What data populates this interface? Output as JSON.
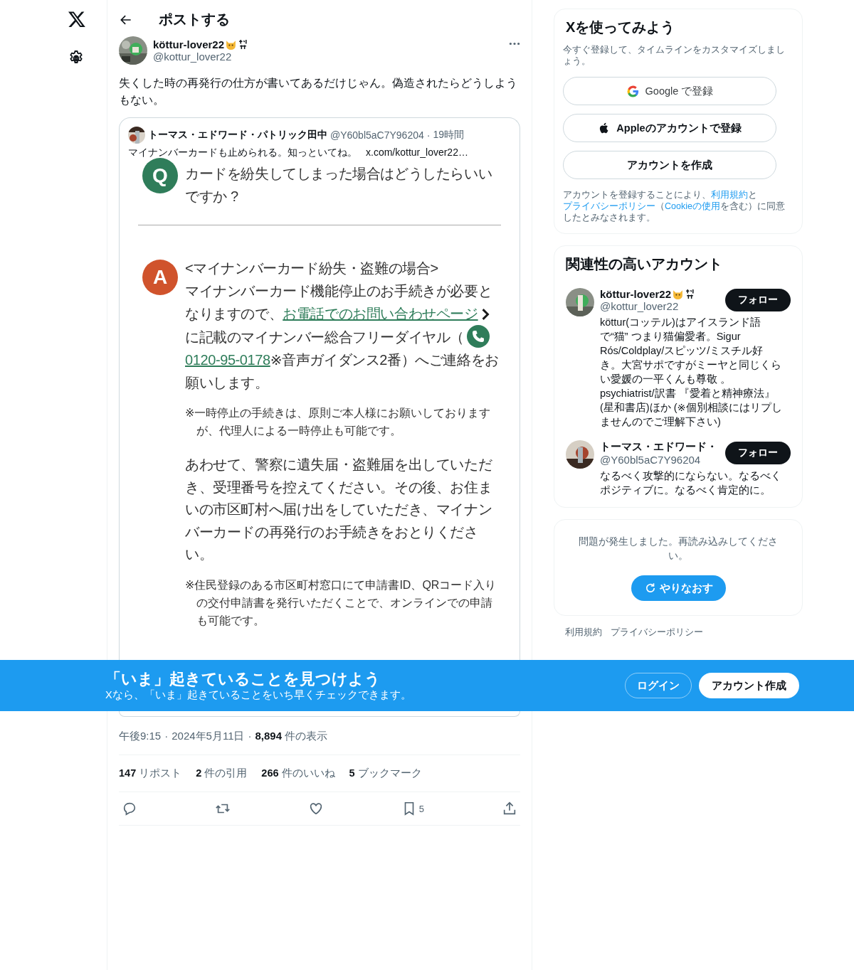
{
  "header": {
    "title": "ポストする"
  },
  "post": {
    "author": {
      "name": "köttur-lover22",
      "handle": "@kottur_lover22"
    },
    "text": "失くした時の再発行の仕方が書いてあるだけじゃん。偽造されたらどうしようもない。",
    "quote": {
      "author": "トーマス・エドワード・パトリック田中",
      "handle": "@Y60bl5aC7Y96204",
      "separator": "·",
      "time": "19時間",
      "text": "マイナンバーカードも止められる。知っといてね。",
      "link": "x.com/kottur_lover22…",
      "document": {
        "question": {
          "mark": "Q",
          "text": "カードを紛失してしまった場合はどうしたらいいですか ?"
        },
        "answer": {
          "mark": "A",
          "heading": "<マイナンバーカード紛失・盗難の場合>",
          "before": "マイナンバーカード機能停止のお手続きが必要となりますので、",
          "link": "お電話でのお問い合わせページ",
          "middle": "に記載のマイナンバー総合フリーダイヤル（",
          "phone": "0120-95-0178",
          "after": "※音声ガイダンス2番）へご連絡をお願いします。",
          "note1": "※一時停止の手続きは、原則ご本人様にお願いしておりますが、代理人による一時停止も可能です。",
          "para2": "あわせて、警察に遺失届・盗難届を出していただき、受理番号を控えてください。その後、お住まいの市区町村へ届け出をしていただき、マイナンバーカードの再発行のお手続きをおとりください。",
          "note2": "※住民登録のある市区町村窓口にて申請書ID、QRコード入りの交付申請書を発行いただくことで、オンラインでの申請も可能です。"
        }
      }
    },
    "time": "午後9:15",
    "separator_1": "·",
    "date": "2024年5月11日",
    "separator_2": "·",
    "views": "8,894",
    "views_label": "件の表示",
    "stats": [
      {
        "count": "147",
        "label": "リポスト"
      },
      {
        "count": "2",
        "label": "件の引用"
      },
      {
        "count": "266",
        "label": "件のいいね"
      },
      {
        "count": "5",
        "label": "ブックマーク"
      }
    ],
    "actions": [
      {
        "kind": "reply"
      },
      {
        "kind": "repost"
      },
      {
        "kind": "like"
      },
      {
        "kind": "bookmark",
        "count": "5"
      },
      {
        "kind": "share"
      }
    ]
  },
  "signup": {
    "title": "Xを使ってみよう",
    "subtitle": "今すぐ登録して、タイムラインをカスタマイズしましょう。",
    "buttons": [
      {
        "kind": "google",
        "label": "Google で登録"
      },
      {
        "kind": "apple",
        "label": "Appleのアカウントで登録"
      },
      {
        "kind": "create",
        "label": "アカウントを作成"
      }
    ],
    "legal": [
      {
        "text": "アカウントを登録することにより、",
        "link": false
      },
      {
        "text": "利用規約",
        "link": true
      },
      {
        "text": "と",
        "link": false
      },
      {
        "text": "プライバシーポリシー",
        "link": true
      },
      {
        "text": "（",
        "link": false
      },
      {
        "text": "Cookieの使用",
        "link": true
      },
      {
        "text": "を含む）に同意したとみなされます。",
        "link": false
      }
    ]
  },
  "accounts": {
    "title": "関連性の高いアカウント",
    "items": [
      {
        "name": "köttur-lover22",
        "badge": true,
        "handle": "@kottur_lover22",
        "button": "フォロー",
        "bio": "köttur(コッテル)はアイスランド語で“猫” つまり猫偏愛者。Sigur Rós/Coldplay/スピッツ/ミスチル好き。大宮サポですがミーヤと同じくらい愛媛の一平くんも尊敬 。psychiatrist/訳書 『愛着と精神療法』(星和書店)ほか (※個別相談にはリプしませんのでご理解下さい)"
      },
      {
        "name": "トーマス・エドワード・",
        "badge": false,
        "handle": "@Y60bl5aC7Y96204",
        "button": "フォロー",
        "bio": "なるべく攻撃的にならない。なるべくポジティブに。なるべく肯定的に。"
      }
    ]
  },
  "error": {
    "text": "問題が発生しました。再読み込みしてください。",
    "button": "やりなおす"
  },
  "footer": [
    "利用規約",
    "プライバシーポリシー"
  ],
  "banner": {
    "title": "「いま」起きていることを見つけよう",
    "subtitle": "Xなら、「いま」起きていることをいち早くチェックできます。",
    "login": "ログイン",
    "signup": "アカウント作成"
  }
}
